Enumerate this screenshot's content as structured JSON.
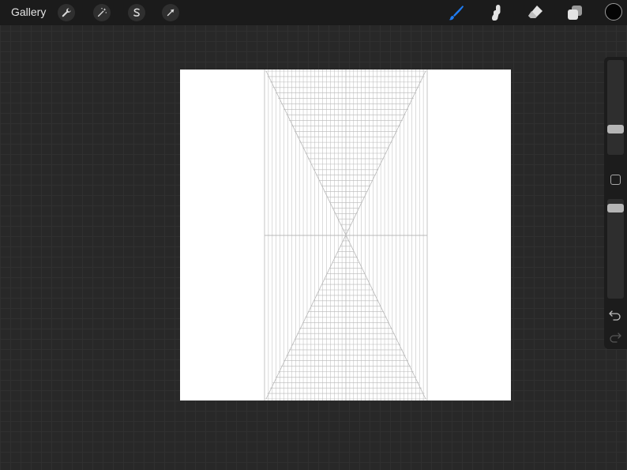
{
  "topbar": {
    "gallery_label": "Gallery",
    "left_tools": [
      {
        "name": "actions",
        "icon": "wrench-icon"
      },
      {
        "name": "adjustments",
        "icon": "magic-wand-icon"
      },
      {
        "name": "selection",
        "icon": "selection-s-icon"
      },
      {
        "name": "transform",
        "icon": "arrow-cursor-icon"
      }
    ],
    "right_tools": [
      {
        "name": "brush",
        "icon": "brush-icon",
        "active": true
      },
      {
        "name": "smudge",
        "icon": "smudge-icon",
        "active": false
      },
      {
        "name": "eraser",
        "icon": "eraser-icon",
        "active": false
      },
      {
        "name": "layers",
        "icon": "layers-icon",
        "active": false
      }
    ],
    "current_color": "#050505"
  },
  "sidebar": {
    "brush_size": 0.25,
    "brush_opacity": 0.95,
    "undo_icon": "undo-icon",
    "redo_icon": "redo-icon",
    "modify_icon": "square-outline-icon"
  },
  "theme": {
    "background": "#282828",
    "topbar": "#1b1b1b",
    "accent": "#1f7cf2",
    "canvas": "#ffffff",
    "guide_lines": "#b8b8b8"
  }
}
